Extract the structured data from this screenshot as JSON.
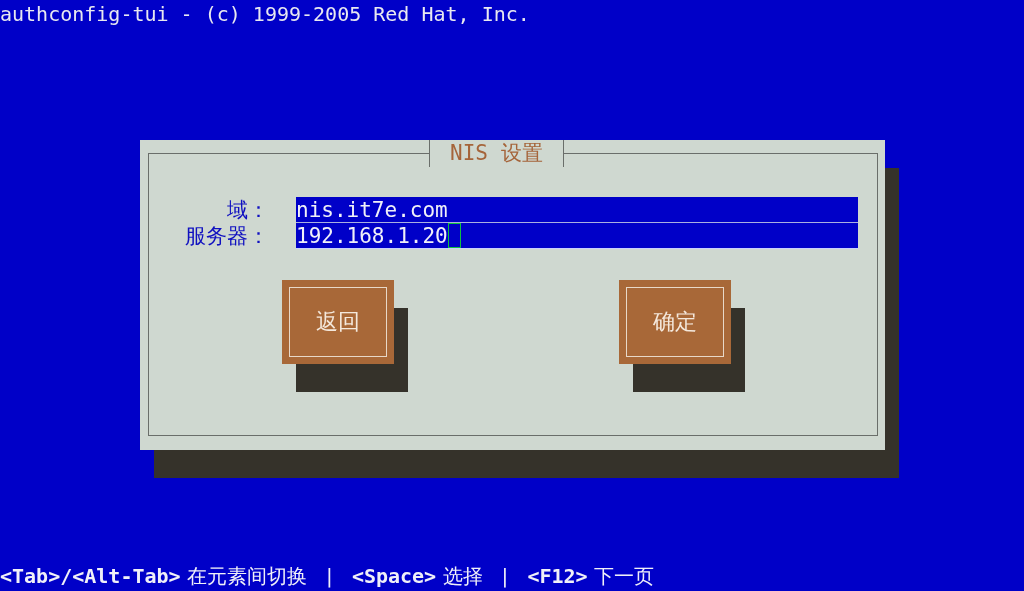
{
  "window": {
    "title": "authconfig-tui - (c) 1999-2005 Red Hat, Inc."
  },
  "dialog": {
    "title": "NIS 设置",
    "fields": [
      {
        "label": "域：",
        "value": "nis.it7e.com",
        "focused": false
      },
      {
        "label": "服务器：",
        "value": "192.168.1.20",
        "focused": true
      }
    ],
    "buttons": [
      "返回",
      "确定"
    ]
  },
  "status_bar": "**<Tab>/<Alt-Tab>** 在元素间切换   |   **<Space>** 选择   |   **<F12>** 下一页"
}
